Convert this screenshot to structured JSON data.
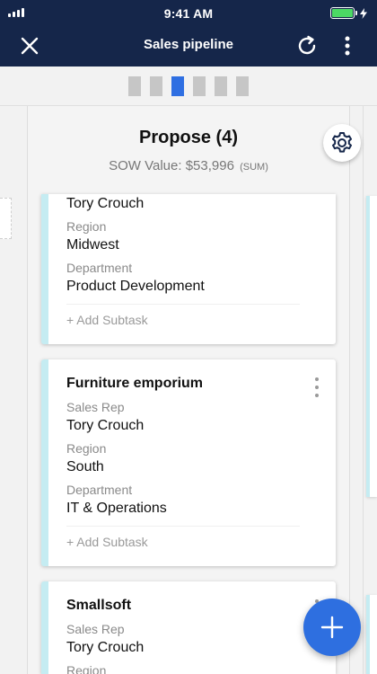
{
  "status_bar": {
    "time": "9:41 AM"
  },
  "nav": {
    "title": "Sales pipeline"
  },
  "indicators": {
    "count": 6,
    "active_index": 2
  },
  "column": {
    "title": "Propose (4)",
    "sow_label": "SOW Value: $53,996",
    "sow_suffix": "(SUM)"
  },
  "cards": [
    {
      "sales_rep_value": "Tory Crouch",
      "region_label": "Region",
      "region_value": "Midwest",
      "department_label": "Department",
      "department_value": "Product Development",
      "add_subtask": "+ Add Subtask"
    },
    {
      "title": "Furniture emporium",
      "sales_rep_label": "Sales Rep",
      "sales_rep_value": "Tory Crouch",
      "region_label": "Region",
      "region_value": "South",
      "department_label": "Department",
      "department_value": "IT & Operations",
      "add_subtask": "+ Add Subtask"
    },
    {
      "title": "Smallsoft",
      "sales_rep_label": "Sales Rep",
      "sales_rep_value": "Tory Crouch",
      "region_label": "Region"
    }
  ],
  "colors": {
    "nav_bg": "#15264a",
    "accent": "#2e6fe0",
    "card_stripe": "#c5ecf2",
    "battery": "#4cd964"
  },
  "icons": [
    "signal-icon",
    "battery-icon",
    "close-icon",
    "refresh-icon",
    "more-vertical-icon",
    "gear-icon",
    "plus-icon"
  ]
}
